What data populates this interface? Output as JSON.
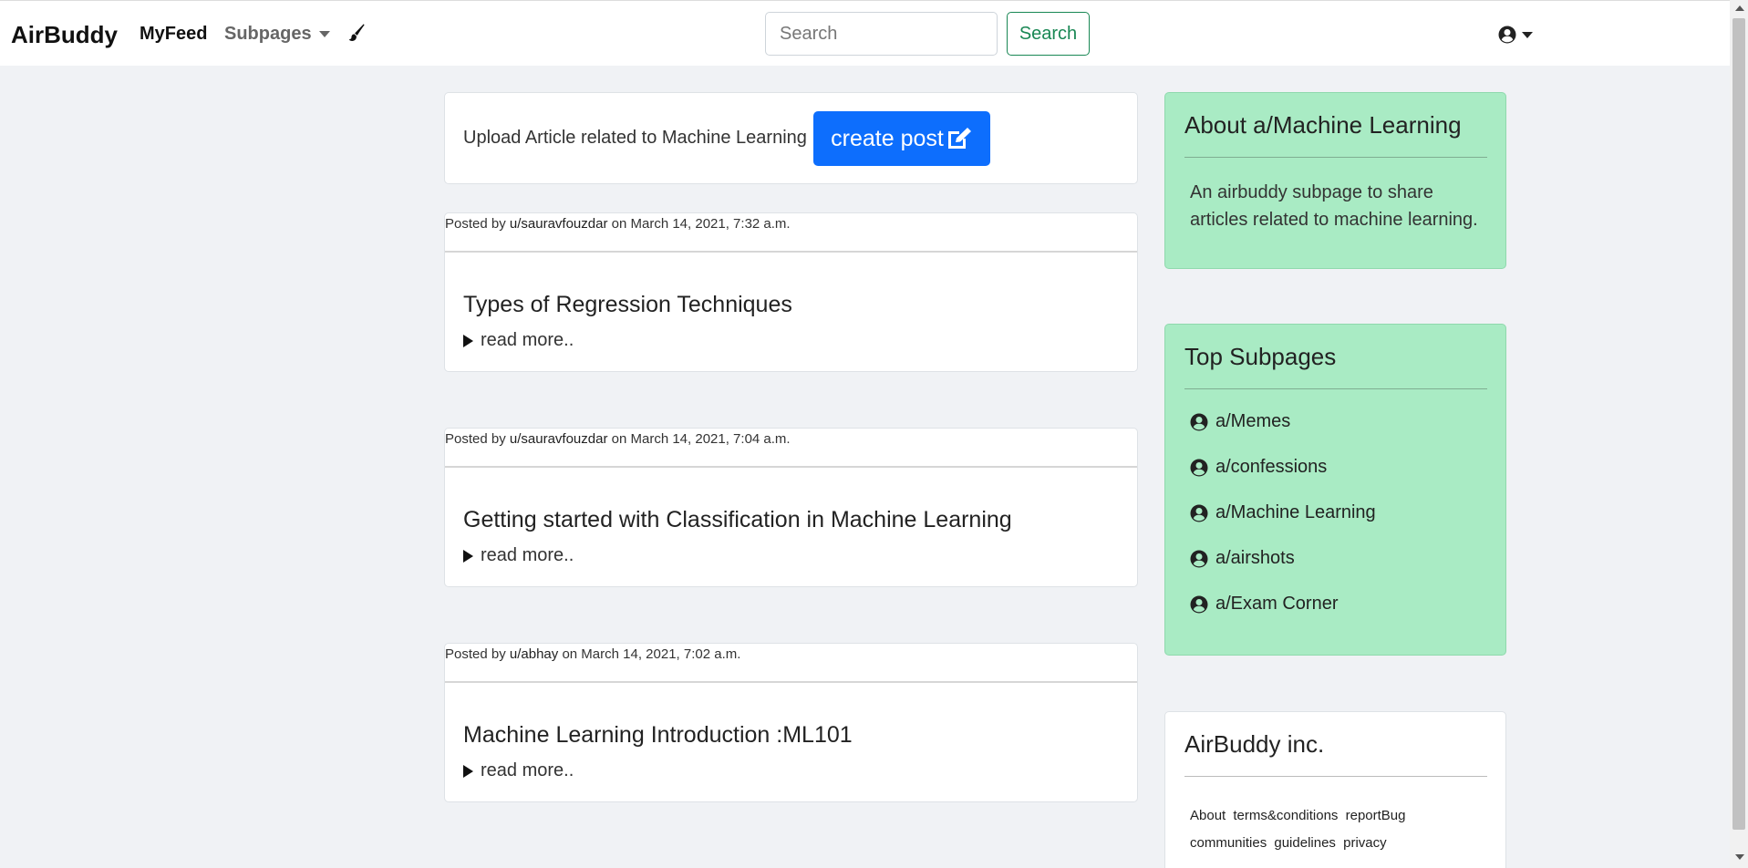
{
  "nav": {
    "brand": "AirBuddy",
    "myfeed": "MyFeed",
    "subpages": "Subpages",
    "search_placeholder": "Search",
    "search_button": "Search"
  },
  "upload": {
    "text": "Upload Article related to Machine Learning",
    "button": "create post"
  },
  "posts": [
    {
      "prefix": "Posted by ",
      "user": "u/sauravfouzdar",
      "date": " on March 14, 2021, 7:32 a.m.",
      "title": "Types of Regression Techniques",
      "read_more": "read more.."
    },
    {
      "prefix": "Posted by ",
      "user": "u/sauravfouzdar",
      "date": " on March 14, 2021, 7:04 a.m.",
      "title": "Getting started with Classification in Machine Learning",
      "read_more": "read more.."
    },
    {
      "prefix": "Posted by ",
      "user": "u/abhay",
      "date": " on March 14, 2021, 7:02 a.m.",
      "title": "Machine Learning Introduction :ML101",
      "read_more": "read more.."
    }
  ],
  "about": {
    "title": "About a/Machine Learning",
    "description": "An airbuddy subpage to share articles related to machine learning."
  },
  "top_subpages": {
    "title": "Top Subpages",
    "items": [
      "a/Memes",
      "a/confessions",
      "a/Machine Learning",
      "a/airshots",
      "a/Exam Corner"
    ]
  },
  "footer": {
    "title": "AirBuddy inc.",
    "links": [
      "About",
      "terms&conditions",
      "reportBug",
      "communities",
      "guidelines",
      "privacy"
    ]
  },
  "colors": {
    "primary": "#0d6efd",
    "success": "#198754",
    "sidebar_green": "#a9ebc4"
  }
}
